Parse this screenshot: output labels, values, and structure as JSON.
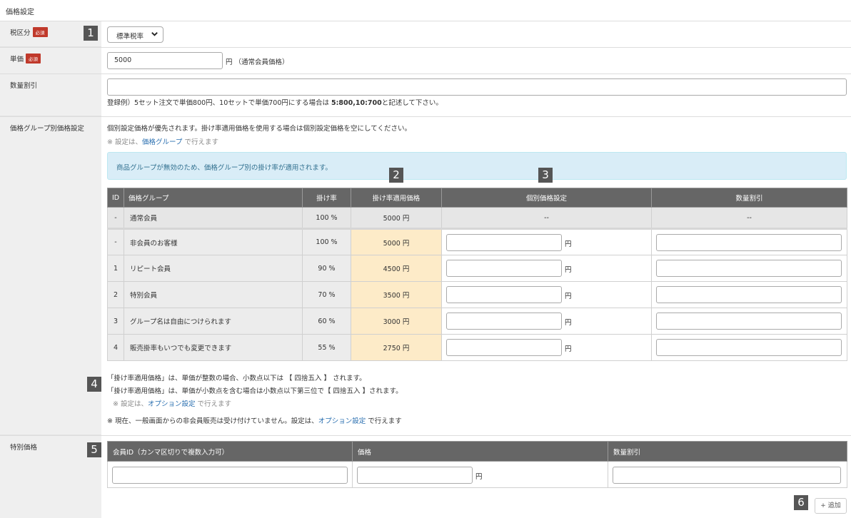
{
  "page": {
    "title": "価格設定",
    "required_label": "必須"
  },
  "badges": [
    "1",
    "2",
    "3",
    "4",
    "5",
    "6"
  ],
  "tax": {
    "label": "税区分",
    "selected": "標準税率"
  },
  "unit_price": {
    "label": "単価",
    "value": "5000",
    "suffix": "円 （通常会員価格）"
  },
  "qty_discount": {
    "label": "数量割引",
    "value": "",
    "example_prefix": "登録例）5セット注文で単価800円、10セットで単価700円にする場合は ",
    "example_bold": "5:800,10:700",
    "example_suffix": "と記述して下さい。"
  },
  "group_price": {
    "label": "価格グループ別価格設定",
    "note1": "個別設定価格が優先されます。掛け率適用価格を使用する場合は個別設定価格を空にしてください。",
    "note2_prefix": "※ 設定は、",
    "note2_link": "価格グループ",
    "note2_suffix": " で行えます",
    "info": "商品グループが無効のため、価格グループ別の掛け率が適用されます。",
    "columns": [
      "ID",
      "価格グループ",
      "掛け率",
      "掛け率適用価格",
      "個別価格設定",
      "数量割引"
    ],
    "yen": "円",
    "base_row": {
      "id": "-",
      "name": "通常会員",
      "rate": "100 %",
      "price": "5000 円",
      "individual": "--",
      "discount": "--"
    },
    "rows": [
      {
        "id": "-",
        "name": "非会員のお客様",
        "rate": "100 %",
        "price": "5000 円"
      },
      {
        "id": "1",
        "name": "リピート会員",
        "rate": "90 %",
        "price": "4500 円"
      },
      {
        "id": "2",
        "name": "特別会員",
        "rate": "70 %",
        "price": "3500 円"
      },
      {
        "id": "3",
        "name": "グループ名は自由につけられます",
        "rate": "60 %",
        "price": "3000 円"
      },
      {
        "id": "4",
        "name": "販売掛率もいつでも変更できます",
        "rate": "55 %",
        "price": "2750 円"
      }
    ],
    "rounding1": "「掛け率適用価格」は、単価が整数の場合、小数点以下は 【 四捨五入 】 されます。",
    "rounding2": "「掛け率適用価格」は、単価が小数点を含む場合は小数点以下第三位で【 四捨五入 】されます。",
    "opt_note_prefix": "※ 設定は、",
    "opt_note_link": "オプション設定",
    "opt_note_suffix": " で行えます",
    "nonmember_prefix": "※ 現在、一般画面からの非会員販売は受け付けていません。設定は、",
    "nonmember_link": "オプション設定",
    "nonmember_suffix": " で行えます"
  },
  "special_price": {
    "label": "特別価格",
    "columns": [
      "会員ID（カンマ区切りで複数入力可）",
      "価格",
      "数量割引"
    ],
    "yen": "円",
    "add_button": "+ 追加"
  }
}
